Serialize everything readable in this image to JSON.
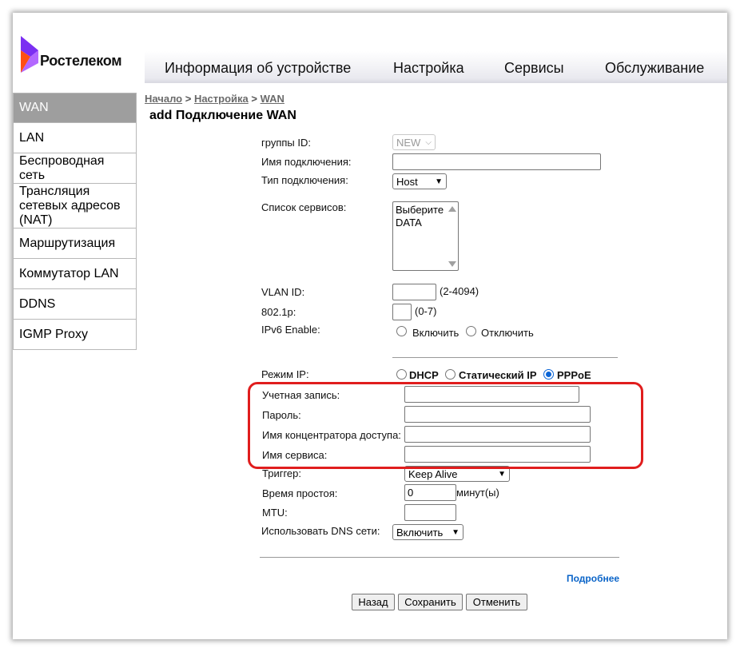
{
  "brand": {
    "name": "Ростелеком",
    "accent_purple": "#7b2ff2",
    "accent_orange": "#ff4f12"
  },
  "topnav": {
    "tabs": [
      "Информация об устройстве",
      "Настройка",
      "Сервисы",
      "Обслуживание"
    ]
  },
  "sidebar": {
    "items": [
      {
        "label": "WAN",
        "active": true
      },
      {
        "label": "LAN"
      },
      {
        "label": "Беспроводная сеть"
      },
      {
        "label": "Трансляция сетевых адресов (NAT)"
      },
      {
        "label": "Маршрутизация"
      },
      {
        "label": "Коммутатор LAN"
      },
      {
        "label": "DDNS"
      },
      {
        "label": "IGMP Proxy"
      }
    ]
  },
  "breadcrumb": {
    "home": "Начало",
    "section": "Настройка",
    "page": "WAN",
    "sep": " > "
  },
  "page_title": "add Подключение WAN",
  "form": {
    "group_id": {
      "label": "группы ID:",
      "value": "NEW"
    },
    "conn_name": {
      "label": "Имя подключения:",
      "value": ""
    },
    "conn_type": {
      "label": "Тип подключения:",
      "value": "Host"
    },
    "services": {
      "label": "Список сервисов:",
      "options": [
        "Выберите",
        "DATA"
      ]
    },
    "vlan_id": {
      "label": "VLAN ID:",
      "value": "",
      "hint": "(2-4094)"
    },
    "dot1p": {
      "label": "802.1p:",
      "value": "",
      "hint": "(0-7)"
    },
    "ipv6": {
      "label": "IPv6 Enable:",
      "on": "Включить",
      "off": "Отключить"
    },
    "ip_mode": {
      "label": "Режим IP:",
      "dhcp": "DHCP",
      "static": "Статический IP",
      "pppoe": "PPPoE",
      "selected": "PPPoE"
    },
    "account": {
      "label": "Учетная запись:",
      "value": ""
    },
    "password": {
      "label": "Пароль:",
      "value": ""
    },
    "ac_name": {
      "label": "Имя концентратора доступа:",
      "value": ""
    },
    "service_name": {
      "label": "Имя сервиса:",
      "value": ""
    },
    "trigger": {
      "label": "Триггер:",
      "value": "Keep Alive"
    },
    "idle_time": {
      "label": "Время простоя:",
      "value": "0",
      "unit": "минут(ы)"
    },
    "mtu": {
      "label": "MTU:",
      "value": ""
    },
    "dns": {
      "label": "Использовать DNS сети:",
      "value": "Включить"
    }
  },
  "links": {
    "more": "Подробнее"
  },
  "buttons": {
    "back": "Назад",
    "save": "Сохранить",
    "cancel": "Отменить"
  },
  "highlight_color": "#e01d1d"
}
